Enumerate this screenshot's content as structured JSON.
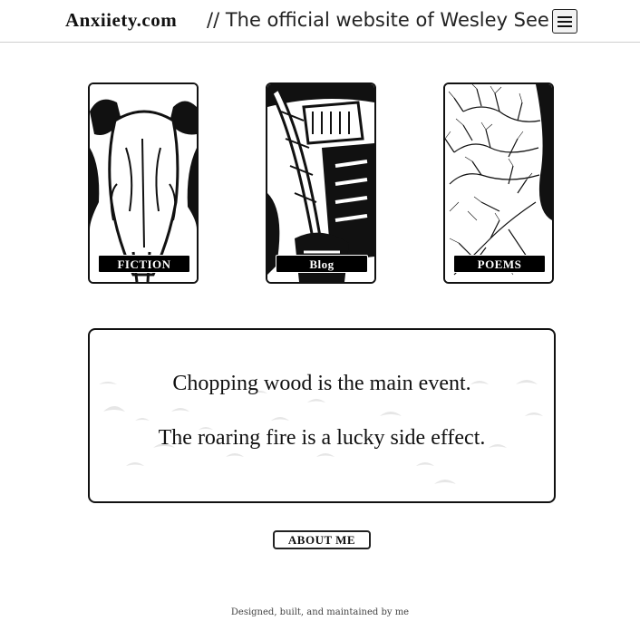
{
  "header": {
    "brand": "Anxiiety.com",
    "subtitle": "// The official website of Wesley See",
    "menu_icon": "hamburger-menu-icon"
  },
  "cards": [
    {
      "label": "Fiction",
      "image": "bull-skull-illustration"
    },
    {
      "label": "Blog",
      "image": "quill-and-inkwell-illustration"
    },
    {
      "label": "Poems",
      "image": "bare-tree-branches-illustration"
    }
  ],
  "quote": {
    "line1": "Chopping wood is the main event.",
    "line2": "The roaring fire is a lucky side effect.",
    "background": "flying-birds-pattern"
  },
  "about_button": "About Me",
  "footer": "Designed, built, and maintained by me",
  "colors": {
    "ink": "#111111",
    "border": "#cfcfcf",
    "bird": "#e6e6e6"
  }
}
